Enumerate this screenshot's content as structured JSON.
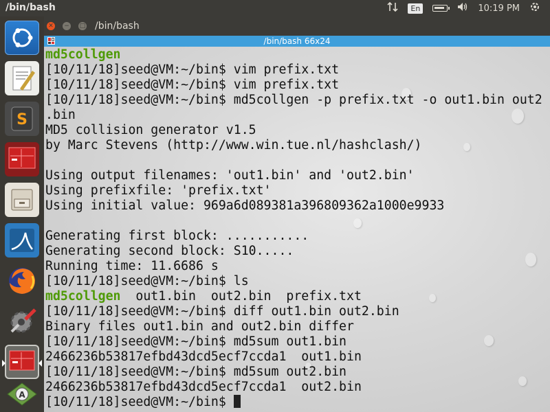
{
  "top_panel": {
    "title": "/bin/bash",
    "lang": "En",
    "clock": "10:19 PM",
    "icons": [
      "sort-arrows-icon",
      "keyboard-language-icon",
      "battery-icon",
      "volume-icon",
      "power-gear-icon"
    ]
  },
  "launcher": {
    "items": [
      {
        "name": "ubuntu-dash-icon"
      },
      {
        "name": "text-editor-icon"
      },
      {
        "name": "sublime-text-icon"
      },
      {
        "name": "terminal-app-icon"
      },
      {
        "name": "file-cabinet-icon"
      },
      {
        "name": "wireshark-icon"
      },
      {
        "name": "firefox-icon"
      },
      {
        "name": "system-settings-icon"
      },
      {
        "name": "active-terminal-icon"
      },
      {
        "name": "software-updater-icon"
      }
    ]
  },
  "window": {
    "title": "/bin/bash",
    "tab_title": "/bin/bash 66x24"
  },
  "terminal": {
    "lines": [
      {
        "text": "",
        "highlight": "md5collgen"
      },
      {
        "text": "[10/11/18]seed@VM:~/bin$ vim prefix.txt"
      },
      {
        "text": "[10/11/18]seed@VM:~/bin$ vim prefix.txt"
      },
      {
        "text": "[10/11/18]seed@VM:~/bin$ md5collgen -p prefix.txt -o out1.bin out2"
      },
      {
        "text": ".bin"
      },
      {
        "text": "MD5 collision generator v1.5"
      },
      {
        "text": "by Marc Stevens (http://www.win.tue.nl/hashclash/)"
      },
      {
        "text": ""
      },
      {
        "text": "Using output filenames: 'out1.bin' and 'out2.bin'"
      },
      {
        "text": "Using prefixfile: 'prefix.txt'"
      },
      {
        "text": "Using initial value: 969a6d089381a396809362a1000e9933"
      },
      {
        "text": ""
      },
      {
        "text": "Generating first block: ..........."
      },
      {
        "text": "Generating second block: S10....."
      },
      {
        "text": "Running time: 11.6686 s"
      },
      {
        "text": "[10/11/18]seed@VM:~/bin$ ls"
      },
      {
        "text": "  out1.bin  out2.bin  prefix.txt",
        "highlight": "md5collgen"
      },
      {
        "text": "[10/11/18]seed@VM:~/bin$ diff out1.bin out2.bin"
      },
      {
        "text": "Binary files out1.bin and out2.bin differ"
      },
      {
        "text": "[10/11/18]seed@VM:~/bin$ md5sum out1.bin"
      },
      {
        "text": "2466236b53817efbd43dcd5ecf7ccda1  out1.bin"
      },
      {
        "text": "[10/11/18]seed@VM:~/bin$ md5sum out2.bin"
      },
      {
        "text": "2466236b53817efbd43dcd5ecf7ccda1  out2.bin"
      },
      {
        "text": "[10/11/18]seed@VM:~/bin$ ",
        "cursor": true
      }
    ]
  },
  "colors": {
    "tab_bar": "#3f9fdb",
    "executable_green": "#4e9a06",
    "close_button": "#e95420"
  }
}
